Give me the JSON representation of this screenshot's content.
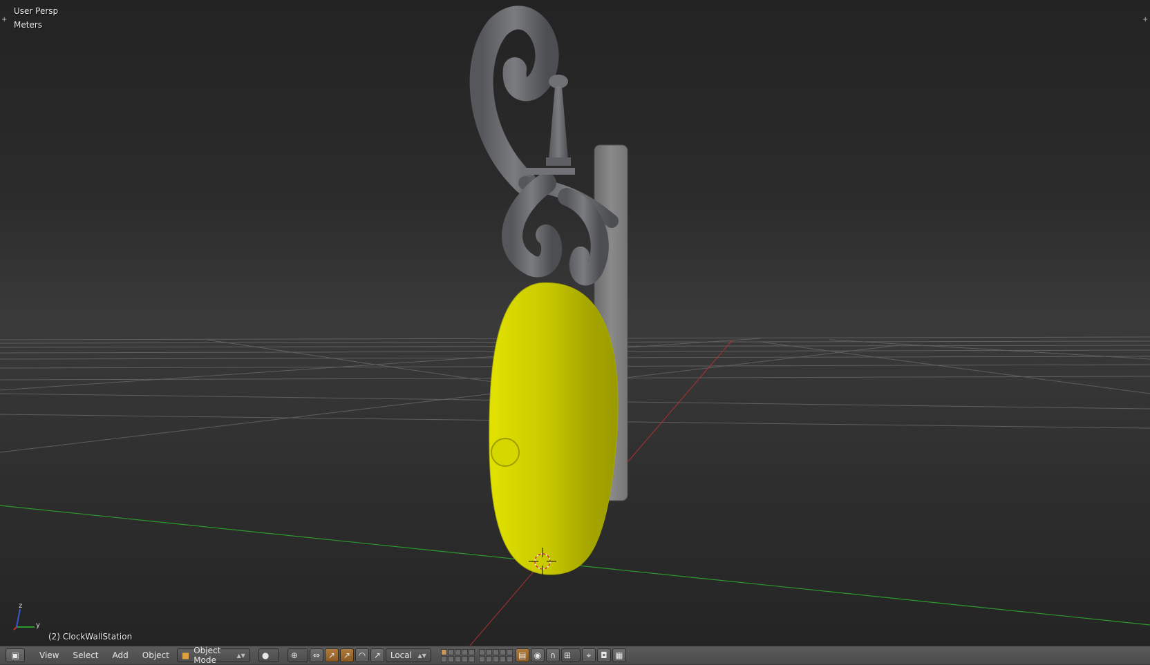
{
  "viewport": {
    "view_label": "User Persp",
    "units_label": "Meters",
    "object_label": "(2) ClockWallStation",
    "axis_labels": {
      "z": "z",
      "y": "y"
    },
    "colors": {
      "selected_object": "#cfcf00",
      "grid_line": "#6a6a6a",
      "x_axis": "#b03030",
      "y_axis": "#2e9a2e",
      "metal": "#6a6c70"
    }
  },
  "header": {
    "editor_type_icon": "3d-view-icon",
    "menu": [
      "View",
      "Select",
      "Add",
      "Object"
    ],
    "mode": "Object Mode",
    "mode_icon": "object-mode-cube-icon",
    "shading_icon": "solid-shading-icon",
    "pivot_icon": "pivot-point-icon",
    "transform_orientation": "Local",
    "icons": [
      "manipulator-icon",
      "translate-icon",
      "rotate-icon",
      "scale-icon",
      "lock-camera-icon",
      "proportional-edit-icon",
      "snap-icon",
      "snap-target-icon",
      "render-icon",
      "render-anim-icon"
    ]
  }
}
